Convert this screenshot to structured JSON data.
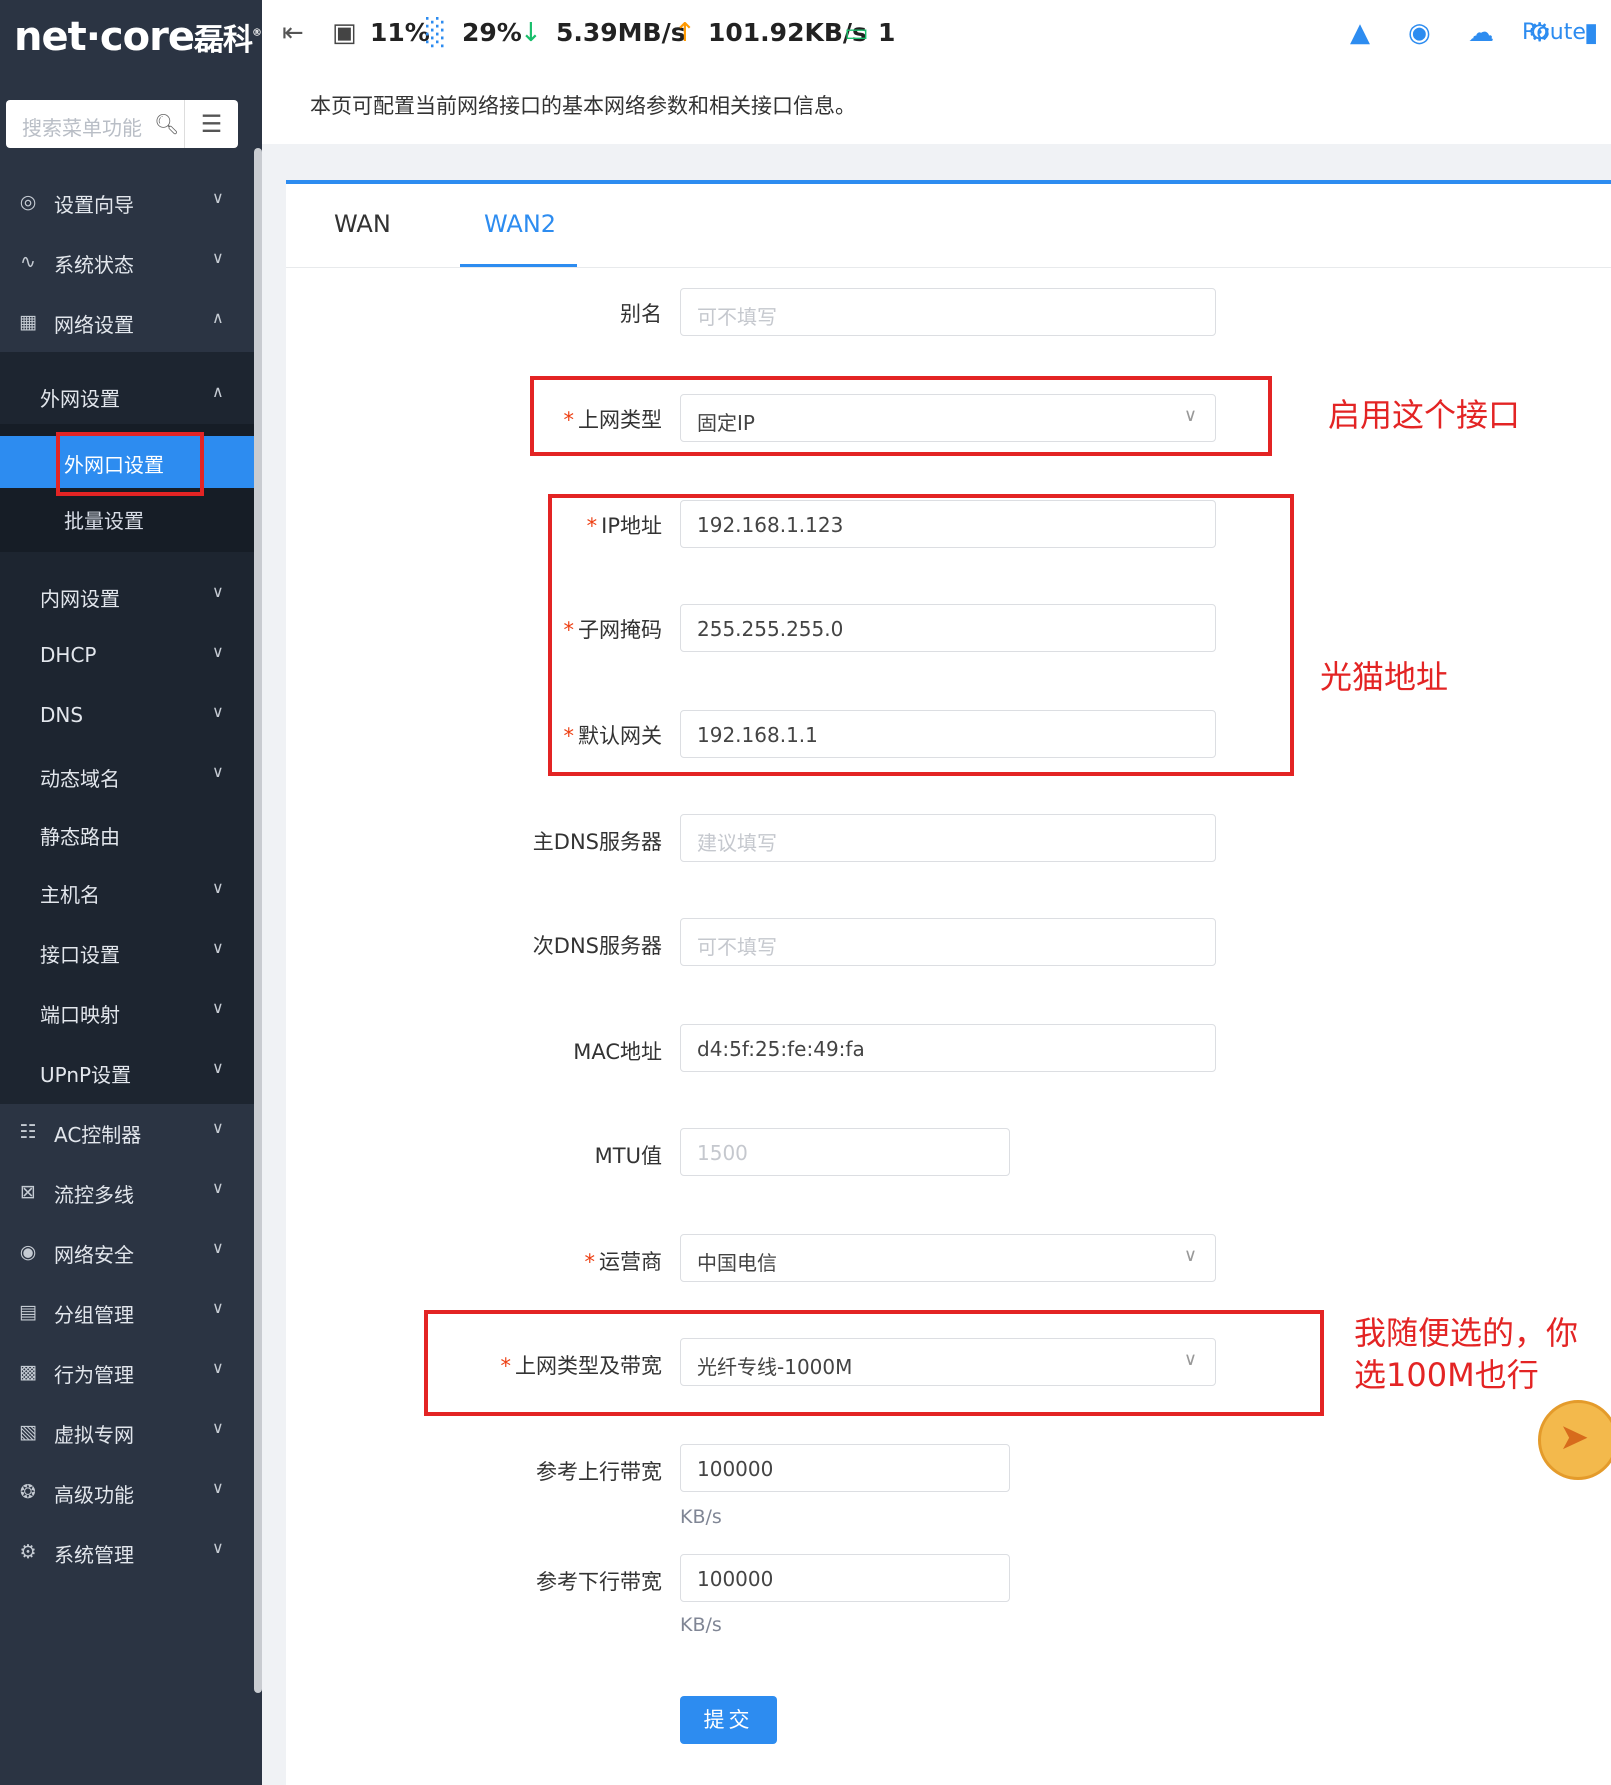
{
  "sidebar": {
    "logo": "net·core",
    "logo_cn": "磊科",
    "search_placeholder": "搜索菜单功能",
    "items": [
      {
        "label": "设置向导",
        "icon": "compass-icon"
      },
      {
        "label": "系统状态",
        "icon": "pulse-icon"
      },
      {
        "label": "网络设置",
        "icon": "building-icon"
      }
    ],
    "submenu": {
      "label": "外网设置",
      "leaves": [
        "外网口设置",
        "批量设置"
      ],
      "others": [
        "内网设置",
        "DHCP",
        "DNS",
        "动态域名",
        "静态路由",
        "主机名",
        "接口设置",
        "端口映射",
        "UPnP设置"
      ]
    },
    "bottom_items": [
      {
        "label": "AC控制器",
        "icon": "network-icon"
      },
      {
        "label": "流控多线",
        "icon": "flow-icon"
      },
      {
        "label": "网络安全",
        "icon": "globe-icon"
      },
      {
        "label": "分组管理",
        "icon": "list-icon"
      },
      {
        "label": "行为管理",
        "icon": "lock-icon"
      },
      {
        "label": "虚拟专网",
        "icon": "vpn-icon"
      },
      {
        "label": "高级功能",
        "icon": "fan-icon"
      },
      {
        "label": "系统管理",
        "icon": "gear-icon"
      }
    ]
  },
  "header": {
    "cpu": "11%",
    "mem": "29%",
    "down": "5.39MB/s",
    "up": "101.92KB/s",
    "devices": "1",
    "router_link": "Router"
  },
  "intro": "本页可配置当前网络接口的基本网络参数和相关接口信息。",
  "tabs": [
    "WAN",
    "WAN2"
  ],
  "form": {
    "alias_label": "别名",
    "alias_placeholder": "可不填写",
    "type_label": "上网类型",
    "type_value": "固定IP",
    "ip_label": "IP地址",
    "ip_value": "192.168.1.123",
    "mask_label": "子网掩码",
    "mask_value": "255.255.255.0",
    "gw_label": "默认网关",
    "gw_value": "192.168.1.1",
    "dns1_label": "主DNS服务器",
    "dns1_placeholder": "建议填写",
    "dns2_label": "次DNS服务器",
    "dns2_placeholder": "可不填写",
    "mac_label": "MAC地址",
    "mac_value": "d4:5f:25:fe:49:fa",
    "mtu_label": "MTU值",
    "mtu_placeholder": "1500",
    "isp_label": "运营商",
    "isp_value": "中国电信",
    "bw_label": "上网类型及带宽",
    "bw_value": "光纤专线-1000M",
    "up_label": "参考上行带宽",
    "up_value": "100000",
    "down_label": "参考下行带宽",
    "down_value": "100000",
    "unit": "KB/s",
    "submit": "提交"
  },
  "annotations": {
    "note1": "启用这个接口",
    "note2": "光猫地址",
    "note3_line1": "我随便选的，你",
    "note3_line2": "选100M也行"
  }
}
